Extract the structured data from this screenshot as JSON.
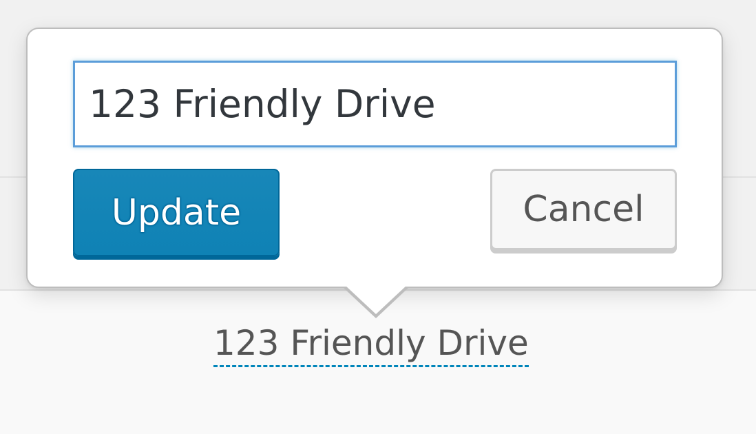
{
  "editor": {
    "address_value": "123 Friendly Drive",
    "update_label": "Update",
    "cancel_label": "Cancel"
  },
  "display": {
    "address_text": "123 Friendly Drive"
  },
  "colors": {
    "primary_button": "#0085ba",
    "input_focus_border": "#5b9dd9",
    "link_dashed_underline": "#0085ba"
  }
}
